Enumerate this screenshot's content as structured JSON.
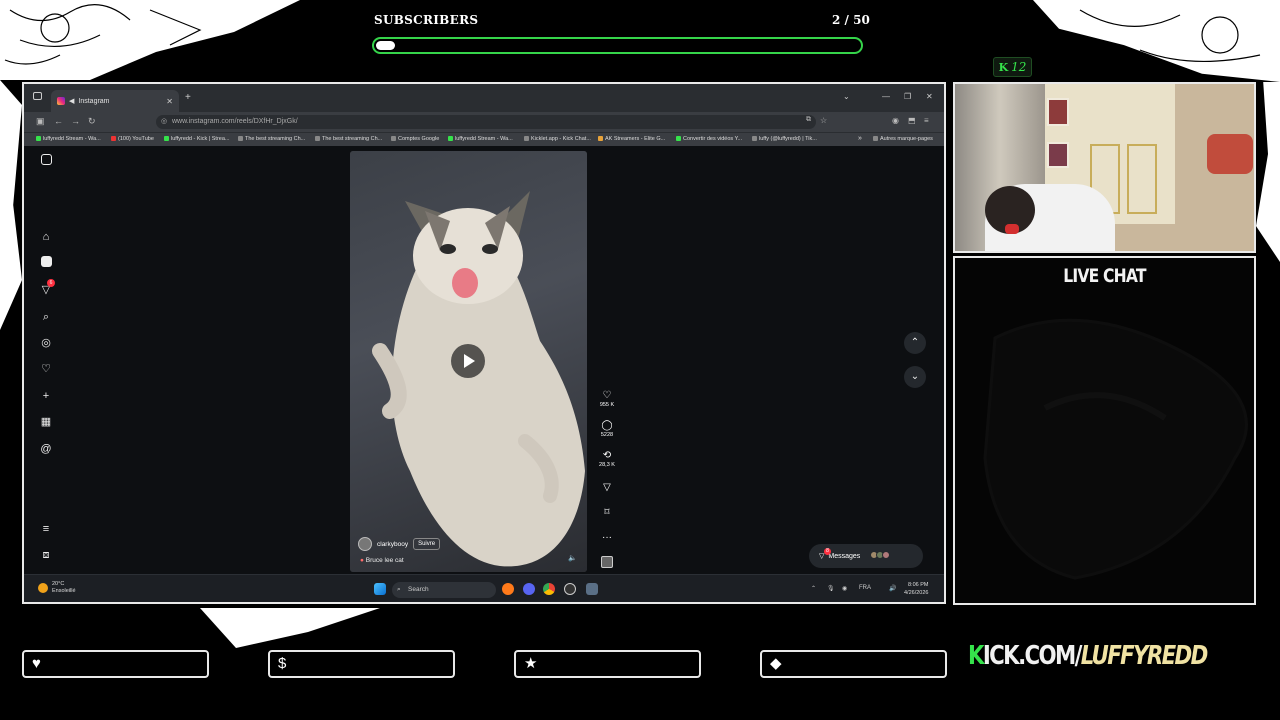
{
  "overlay": {
    "subscribers": {
      "label": "SUBSCRIBERS",
      "count_text": "2 / 50",
      "progress": 0.04
    },
    "kick_badge": {
      "icon": "kick-logo-icon",
      "value": "12"
    },
    "live_chat_title": "LIVE CHAT",
    "stat_boxes": [
      {
        "icon": "heart-icon",
        "glyph": "♥",
        "value": ""
      },
      {
        "icon": "dollar-icon",
        "glyph": "$",
        "value": ""
      },
      {
        "icon": "star-icon",
        "glyph": "★",
        "value": ""
      },
      {
        "icon": "diamond-icon",
        "glyph": "◆",
        "value": ""
      }
    ],
    "kick_url": {
      "k": "K",
      "rest": "ICK.COM/",
      "name": "LUFFYREDD"
    },
    "colors": {
      "accent_green": "#35d44a",
      "frame": "#e9e9e9"
    }
  },
  "browser": {
    "tab_title": "Instagram",
    "url": "www.instagram.com/reels/DXfHr_DjxGk/",
    "bookmarks": [
      "luffyredd Stream - Wa...",
      "(100) YouTube",
      "luffyredd - Kick | Strea...",
      "The best streaming Ch...",
      "The best streaming Ch...",
      "Comptes Google",
      "luffyredd Stream - Wa...",
      "Kicklet.app - Kick Chat...",
      "AK Streamers - Elite G...",
      "Convertir des vidéos Y...",
      "luffy (@luffyredd) | Tik..."
    ],
    "bookmarks_folder": "Autres marque-pages"
  },
  "instagram": {
    "notification_count": "6",
    "reel": {
      "username": "clarkybooy",
      "follow_label": "Suivre",
      "caption": "Bruce lee cat",
      "likes": "955 K",
      "comments": "5228",
      "reposts": "28,3 K"
    },
    "messages_label": "Messages",
    "messages_badge": "8"
  },
  "taskbar": {
    "weather_temp": "20°C",
    "weather_desc": "Ensoleillé",
    "search_label": "Search",
    "language": "FRA",
    "time": "8:06 PM",
    "date": "4/26/2026"
  }
}
